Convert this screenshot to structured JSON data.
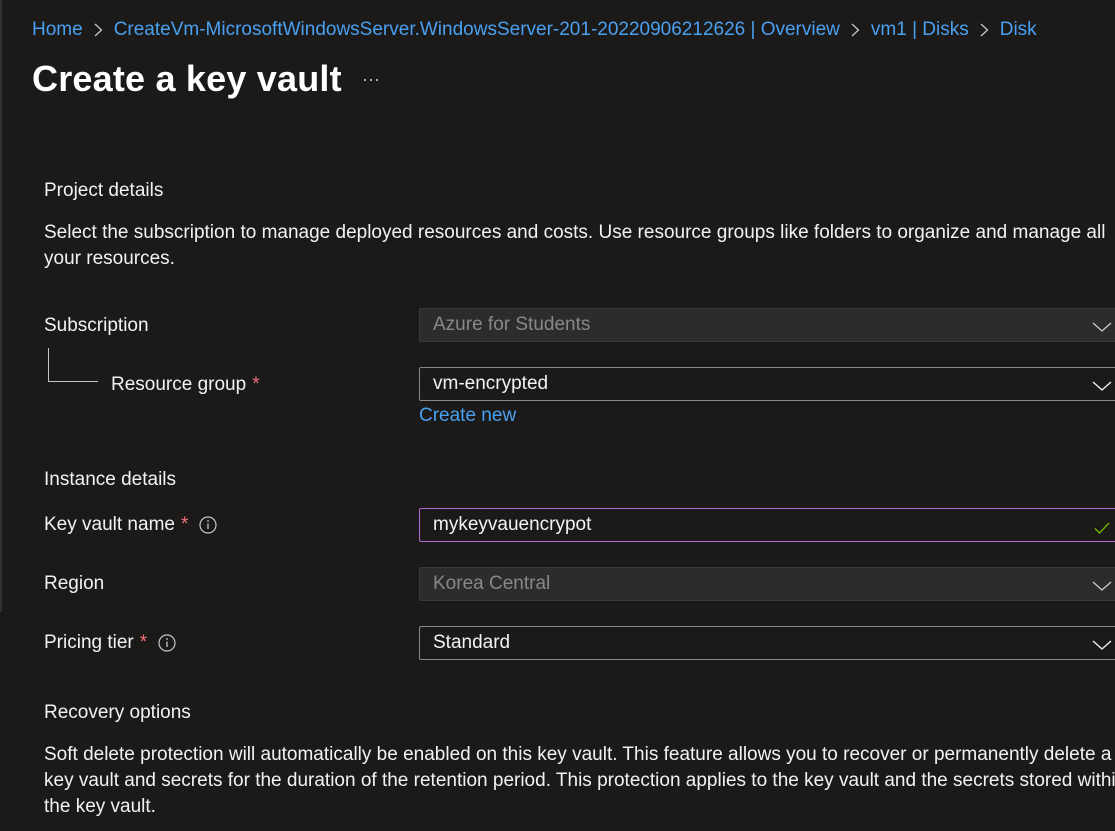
{
  "breadcrumb": {
    "items": [
      "Home",
      "CreateVm-MicrosoftWindowsServer.WindowsServer-201-20220906212626 | Overview",
      "vm1 | Disks",
      "Disk"
    ]
  },
  "page": {
    "title": "Create a key vault",
    "more_label": "···"
  },
  "project_details": {
    "heading": "Project details",
    "description": "Select the subscription to manage deployed resources and costs. Use resource groups like folders to organize and manage all your resources."
  },
  "subscription": {
    "label": "Subscription",
    "value": "Azure for Students"
  },
  "resource_group": {
    "label": "Resource group",
    "required_mark": "*",
    "value": "vm-encrypted",
    "create_new": "Create new"
  },
  "instance_details": {
    "heading": "Instance details"
  },
  "key_vault_name": {
    "label": "Key vault name",
    "required_mark": "*",
    "value": "mykeyvauencrypot"
  },
  "region": {
    "label": "Region",
    "value": "Korea Central"
  },
  "pricing_tier": {
    "label": "Pricing tier",
    "required_mark": "*",
    "value": "Standard"
  },
  "recovery_options": {
    "heading": "Recovery options",
    "description": "Soft delete protection will automatically be enabled on this key vault. This feature allows you to recover or permanently delete a key vault and secrets for the duration of the retention period. This protection applies to the key vault and the secrets stored within the key vault."
  },
  "icons": {
    "chevron": "chevron-down-icon",
    "info": "info-icon",
    "check": "checkmark-icon",
    "separator": "chevron-right-icon"
  },
  "colors": {
    "link": "#4aa0f0",
    "required": "#f1707b",
    "focus_border": "#b16cd2",
    "valid_check": "#6bb700",
    "background": "#1b1a19"
  }
}
